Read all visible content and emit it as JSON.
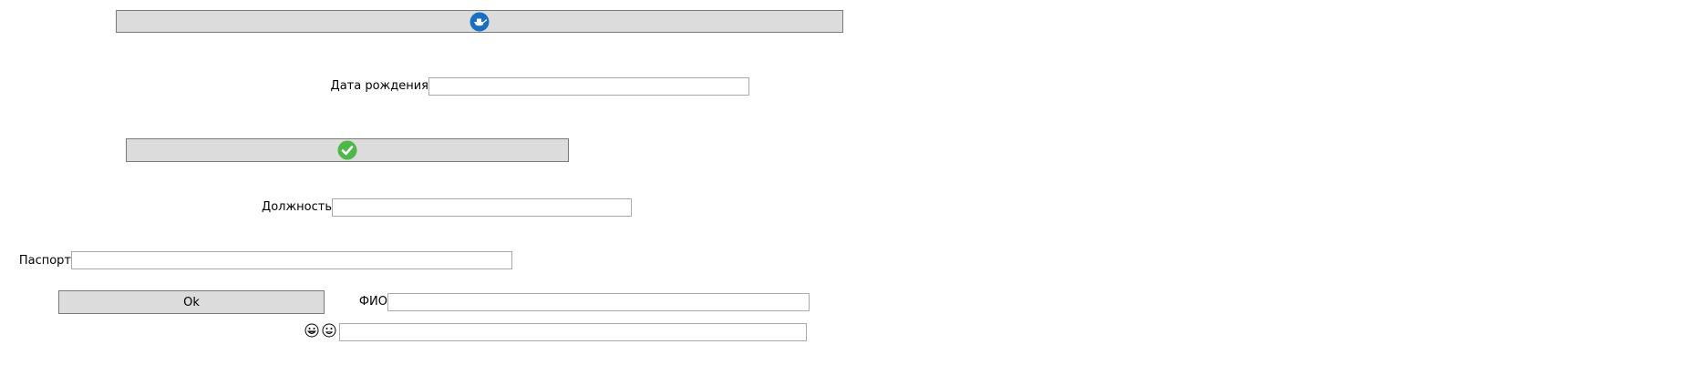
{
  "window": {
    "bg_color": "#ffffff"
  },
  "buttons": {
    "top_icon_button": {
      "icon": "boat-icon",
      "icon_color": "#1a6fc0"
    },
    "check_button": {
      "icon": "checkmark-circle-icon",
      "icon_color": "#4db848"
    },
    "ok_button": {
      "label": "Ok"
    },
    "face_color": "#dcdcdc",
    "border_color": "#7a7a7a"
  },
  "fields": {
    "birth_date": {
      "label": "Дата рождения",
      "value": ""
    },
    "position": {
      "label": "Должность",
      "value": ""
    },
    "passport": {
      "label": "Паспорт",
      "value": ""
    },
    "full_name": {
      "label": "ФИО",
      "value": ""
    },
    "emoji_field": {
      "label_icons": [
        "grinning-face-icon",
        "smiling-face-icon"
      ],
      "value": ""
    }
  }
}
